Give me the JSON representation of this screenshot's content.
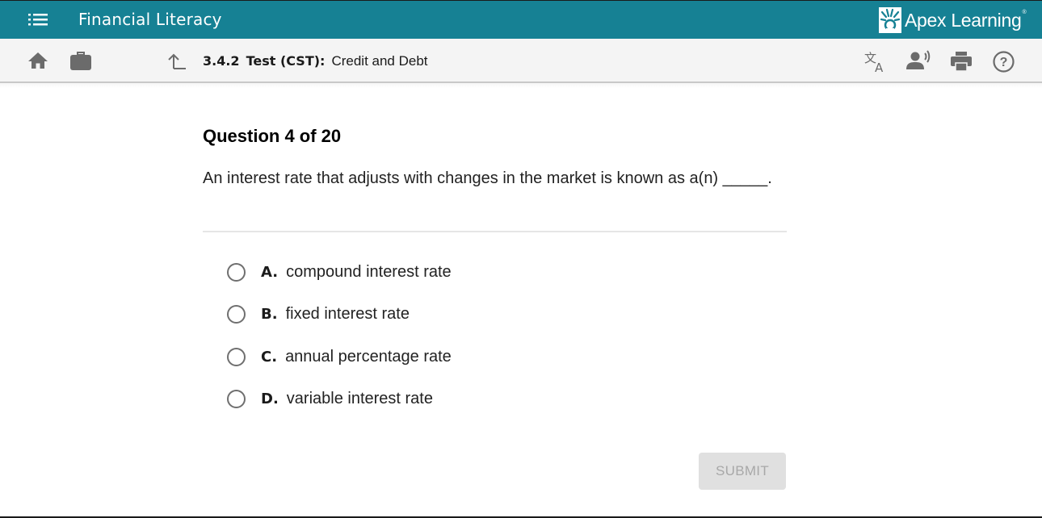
{
  "header": {
    "app_title": "Financial Literacy",
    "brand_name": "Apex Learning",
    "brand_mark": "®",
    "menu_icon": "list-menu-icon",
    "brand_color": "#168194"
  },
  "toolbar": {
    "icons": {
      "home": "home-icon",
      "briefcase": "briefcase-icon",
      "up": "up-arrow-icon",
      "translate": "translate-icon",
      "read_aloud": "read-aloud-icon",
      "print": "print-icon",
      "help": "help-icon"
    },
    "breadcrumb": {
      "number": "3.4.2",
      "type": "Test (CST):",
      "title": "Credit and Debt"
    }
  },
  "question": {
    "heading": "Question 4 of 20",
    "text": "An interest rate that adjusts with changes in the market is known as a(n) _____.",
    "options": [
      {
        "letter": "A.",
        "text": "compound interest rate",
        "selected": false
      },
      {
        "letter": "B.",
        "text": "fixed interest rate",
        "selected": false
      },
      {
        "letter": "C.",
        "text": "annual percentage rate",
        "selected": false
      },
      {
        "letter": "D.",
        "text": "variable interest rate",
        "selected": false
      }
    ]
  },
  "actions": {
    "submit_label": "SUBMIT",
    "submit_enabled": false
  }
}
